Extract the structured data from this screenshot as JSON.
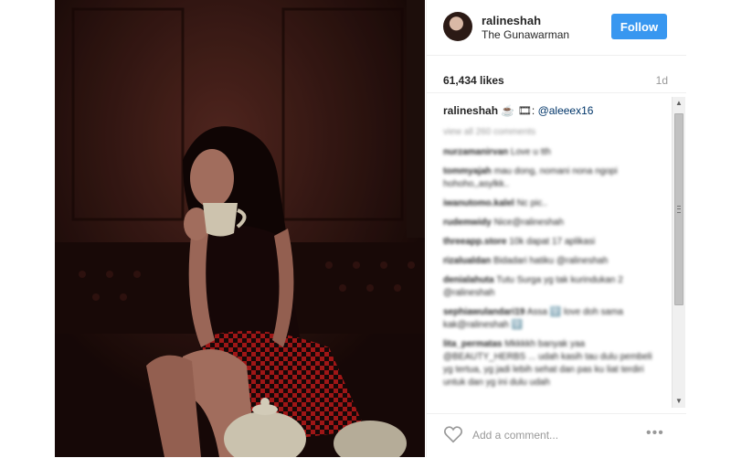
{
  "post": {
    "username": "ralineshah",
    "location": "The Gunawarman",
    "follow_label": "Follow",
    "likes": "61,434 likes",
    "time_ago": "1d"
  },
  "caption": {
    "username": "ralineshah",
    "emoji": "☕ 🎞:",
    "mention": "@aleeex16"
  },
  "comments": {
    "view_all": "view all 260 comments",
    "items": [
      {
        "user": "nurzamanirvan",
        "text": "Love u tth"
      },
      {
        "user": "tommyajah",
        "text": "mau dong, nomani nona ngopi hohoho,,asylkk.."
      },
      {
        "user": "iwanutomo.kalel",
        "text": "Nc pic.."
      },
      {
        "user": "rudemwidy",
        "text": "Nice@ralineshah"
      },
      {
        "user": "threeapp.store",
        "text": "10k dapat 17 aplikasi"
      },
      {
        "user": "rizalualdan",
        "text": "Bidadari hatiku @ralineshah"
      },
      {
        "user": "denialahuta",
        "text": "Tutu Surga yg tak kurindukan 2 @ralineshah"
      },
      {
        "user": "sephiawulandari19",
        "text": "Assa 🈳 love doh sama kak@ralineshah 🈳"
      },
      {
        "user": "lita_permatas",
        "text": "Mkkkkh banyak yaa @BEAUTY_HERBS ... udah kasih tau dulu pembeli yg tertua, yg jadi lebih sehat dan pas ku liat terdiri untuk dan yg ini dulu udah"
      }
    ]
  },
  "add_comment_placeholder": "Add a comment...",
  "more_label": "•••",
  "icons": {
    "heart": "heart-outline-icon",
    "scroll_up": "scroll-up-arrow-icon",
    "scroll_down": "scroll-down-arrow-icon"
  }
}
